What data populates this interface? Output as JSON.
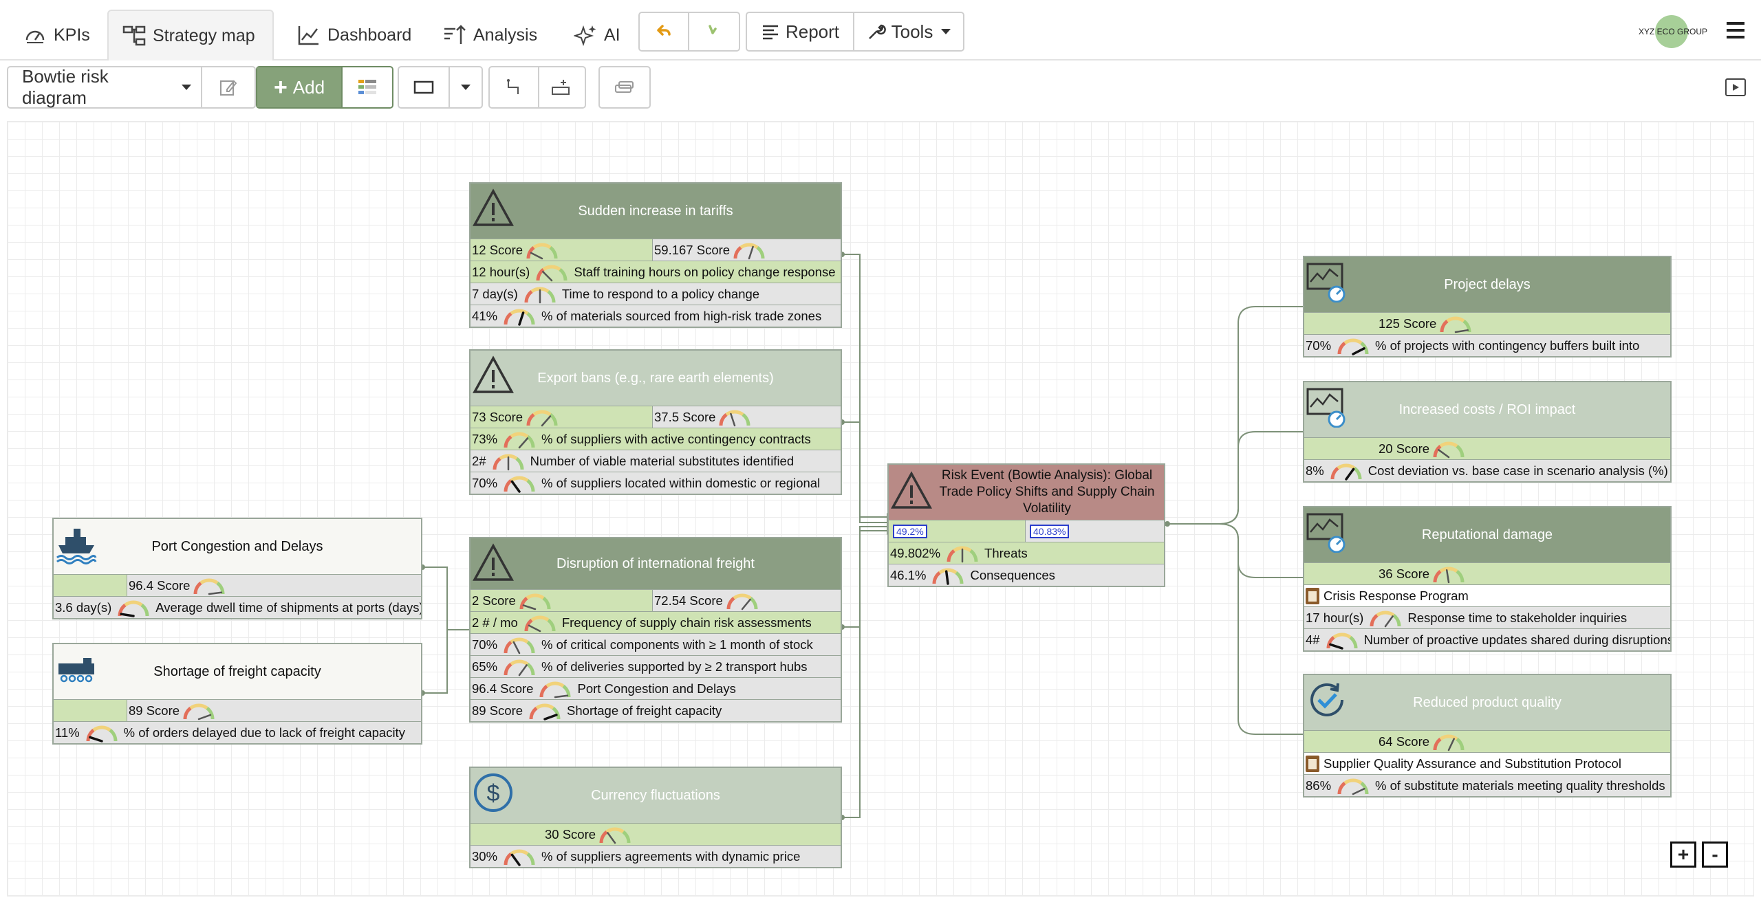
{
  "nav": {
    "tabs": [
      {
        "label": "KPIs",
        "icon": "gauge-icon"
      },
      {
        "label": "Strategy map",
        "icon": "hierarchy-icon",
        "active": true
      },
      {
        "label": "Dashboard",
        "icon": "line-chart-icon"
      },
      {
        "label": "Analysis",
        "icon": "sort-icon"
      },
      {
        "label": "AI",
        "icon": "sparkle-icon"
      }
    ],
    "undo_icon": "undo-icon",
    "redo_icon": "redo-icon",
    "report_label": "Report",
    "tools_label": "Tools",
    "company": "XYZ ECO GROUP"
  },
  "toolbar": {
    "diagram_select": "Bowtie risk diagram",
    "add_label": "Add"
  },
  "colors": {
    "header_dark": "#8b9e83",
    "header_light": "#c3d0bf",
    "risk_header": "#b88a86",
    "value_green": "#cfe3b4",
    "link": "#7d9178"
  },
  "nodes": {
    "tariffs": {
      "title": "Sudden increase in tariffs",
      "icon": "warning-icon",
      "score_left": "12 Score",
      "score_right": "59.167 Score",
      "rows": [
        {
          "value": "12 hour(s)",
          "label": "Staff training hours on policy change response",
          "highlight": true
        },
        {
          "value": "7 day(s)",
          "label": "Time to respond to a policy change"
        },
        {
          "value": "41%",
          "label": "% of materials sourced from high-risk trade zones"
        }
      ]
    },
    "export_bans": {
      "title": "Export bans (e.g., rare earth elements)",
      "icon": "warning-icon",
      "score_left": "73 Score",
      "score_right": "37.5 Score",
      "rows": [
        {
          "value": "73%",
          "label": "% of suppliers with active contingency contracts",
          "highlight": true
        },
        {
          "value": "2#",
          "label": "Number of viable material substitutes identified"
        },
        {
          "value": "70%",
          "label": "% of suppliers located within domestic or regional"
        }
      ]
    },
    "port": {
      "title": "Port Congestion and Delays",
      "icon": "ship-icon",
      "score": "96.4 Score",
      "rows": [
        {
          "value": "3.6 day(s)",
          "label": "Average dwell time of shipments at ports (days)"
        }
      ]
    },
    "freight_capacity": {
      "title": "Shortage of freight capacity",
      "icon": "train-icon",
      "score": "89 Score",
      "rows": [
        {
          "value": "11%",
          "label": "% of orders delayed due to lack of freight capacity"
        }
      ]
    },
    "disruption": {
      "title": "Disruption of international freight",
      "icon": "warning-icon",
      "score_left": "2 Score",
      "score_right": "72.54 Score",
      "rows": [
        {
          "value": "2 # / mo",
          "label": "Frequency of supply chain risk assessments",
          "highlight": true
        },
        {
          "value": "70%",
          "label": "% of critical components with ≥ 1 month of stock"
        },
        {
          "value": "65%",
          "label": "% of deliveries supported by ≥ 2 transport hubs"
        },
        {
          "value": "96.4 Score",
          "label": "Port Congestion and Delays"
        },
        {
          "value": "89 Score",
          "label": "Shortage of freight capacity"
        }
      ]
    },
    "currency": {
      "title": "Currency fluctuations",
      "icon": "dollar-icon",
      "score": "30 Score",
      "rows": [
        {
          "value": "30%",
          "label": "% of suppliers agreements with dynamic price"
        }
      ]
    },
    "risk": {
      "title": "Risk Event (Bowtie Analysis): Global Trade Policy Shifts and Supply Chain Volatility",
      "icon": "warning-icon",
      "pct_left": "49.2%",
      "pct_right": "40.83%",
      "rows": [
        {
          "value": "49.802%",
          "label": "Threats",
          "highlight": true
        },
        {
          "value": "46.1%",
          "label": "Consequences"
        }
      ]
    },
    "project_delays": {
      "title": "Project delays",
      "icon": "chart-gauge-icon",
      "score": "125 Score",
      "rows": [
        {
          "value": "70%",
          "label": "% of projects with contingency buffers built into"
        }
      ]
    },
    "costs": {
      "title": "Increased costs / ROI impact",
      "icon": "chart-gauge-icon",
      "score": "20 Score",
      "rows": [
        {
          "value": "8%",
          "label": "Cost deviation vs. base case in scenario analysis (%)"
        }
      ]
    },
    "reputation": {
      "title": "Reputational damage",
      "icon": "chart-gauge-icon",
      "score": "36 Score",
      "program": "Crisis Response Program",
      "rows": [
        {
          "value": "17 hour(s)",
          "label": "Response time to stakeholder inquiries"
        },
        {
          "value": "4#",
          "label": "Number of proactive updates shared during disruptions"
        }
      ]
    },
    "quality": {
      "title": "Reduced product quality",
      "icon": "cycle-check-icon",
      "score": "64 Score",
      "program": "Supplier Quality Assurance and Substitution Protocol",
      "rows": [
        {
          "value": "86%",
          "label": "% of substitute materials meeting quality thresholds"
        }
      ]
    }
  },
  "zoom": {
    "in": "+",
    "out": "-"
  }
}
